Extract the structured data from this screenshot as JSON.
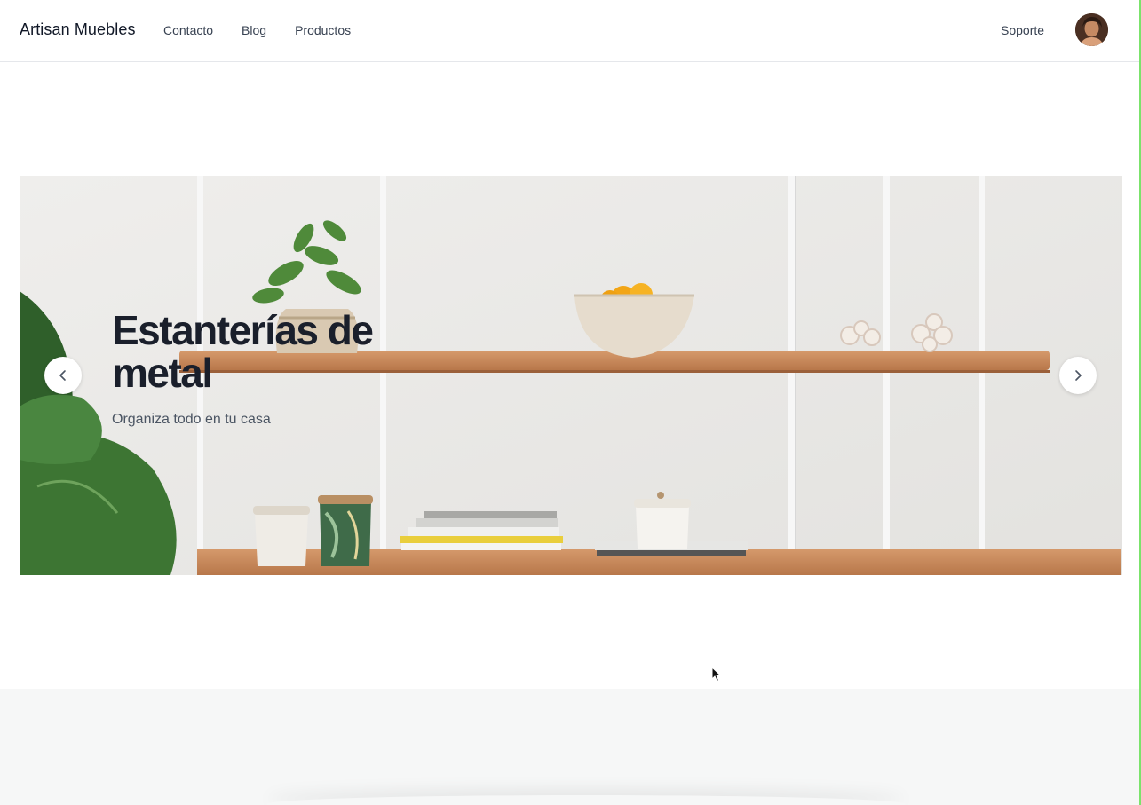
{
  "header": {
    "brand": "Artisan Muebles",
    "nav": [
      "Contacto",
      "Blog",
      "Productos"
    ],
    "support": "Soporte",
    "avatar_icon": "user-avatar"
  },
  "hero": {
    "title": "Estanterías de metal",
    "subtitle": "Organiza todo en tu casa",
    "prev_icon": "chevron-left-icon",
    "next_icon": "chevron-right-icon"
  },
  "colors": {
    "title": "#1a1f2b",
    "shelf_wood": "#c98a5c",
    "background_wall": "#ecebe9",
    "accent_edge": "#7be36b"
  }
}
